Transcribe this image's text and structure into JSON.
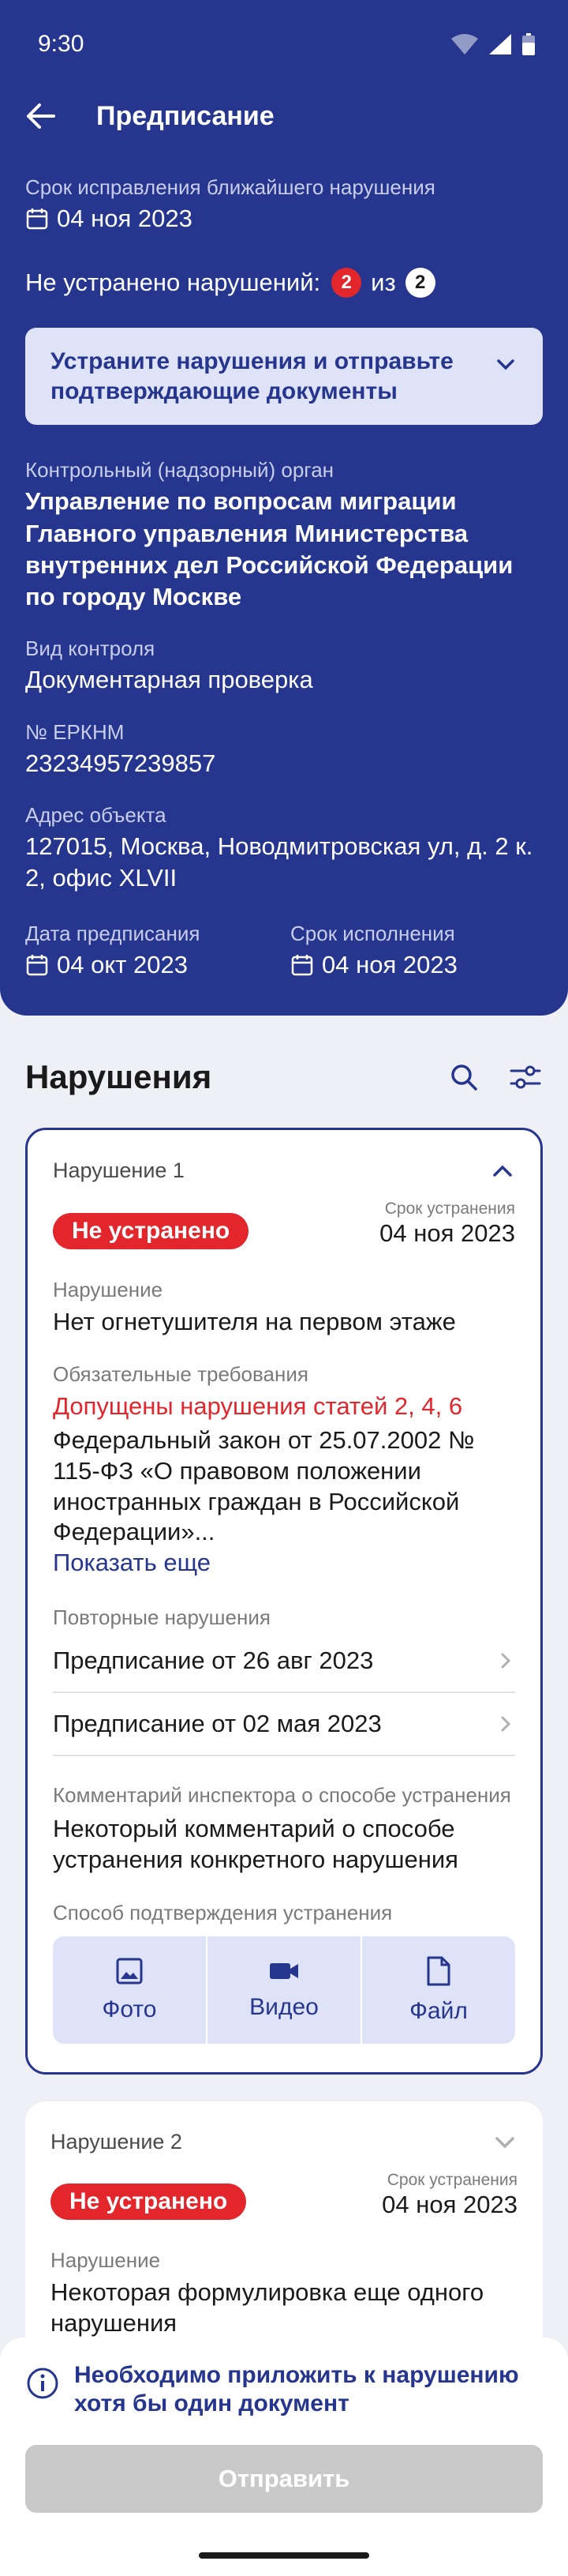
{
  "status_bar": {
    "time": "9:30"
  },
  "topbar": {
    "title": "Предписание"
  },
  "header": {
    "nearest_deadline_label": "Срок исправления ближайшего нарушения",
    "nearest_deadline_value": "04 ноя 2023",
    "unresolved_prefix": "Не устранено нарушений:",
    "unresolved_count": "2",
    "unresolved_of": "из",
    "total_count": "2",
    "alert_text": "Устраните нарушения и отправьте подтверждающие документы",
    "authority_label": "Контрольный (надзорный) орган",
    "authority_value": "Управление по вопросам миграции Главного управления Министерства внутренних дел Российской Федерации по городу Москве",
    "control_type_label": "Вид контроля",
    "control_type_value": "Документарная проверка",
    "erknm_label": "№ ЕРКНМ",
    "erknm_value": "23234957239857",
    "address_label": "Адрес объекта",
    "address_value": "127015, Москва, Новодмитровская ул, д. 2 к. 2, офис XLVII",
    "issue_date_label": "Дата предписания",
    "issue_date_value": "04 окт 2023",
    "due_date_label": "Срок исполнения",
    "due_date_value": "04 ноя 2023"
  },
  "violations_section": {
    "title": "Нарушения"
  },
  "violation1": {
    "title": "Нарушение 1",
    "status": "Не устранено",
    "deadline_label": "Срок устранения",
    "deadline_value": "04 ноя 2023",
    "violation_label": "Нарушение",
    "violation_value": "Нет огнетушителя на первом этаже",
    "requirements_label": "Обязательные требования",
    "requirements_alert": "Допущены нарушения статей 2, 4, 6",
    "requirements_text": "Федеральный закон от 25.07.2002 № 115-ФЗ «О правовом положении иностранных граждан в Российской Федерации»...",
    "show_more": "Показать еще",
    "repeat_label": "Повторные нарушения",
    "repeat_items": [
      "Предписание от 26 авг 2023",
      "Предписание от 02 мая 2023"
    ],
    "comment_label": "Комментарий инспектора о способе устранения",
    "comment_value": "Некоторый комментарий о способе устранения конкретного нарушения",
    "confirm_label": "Способ подтверждения устранения",
    "methods": [
      "Фото",
      "Видео",
      "Файл"
    ]
  },
  "violation2": {
    "title": "Нарушение 2",
    "status": "Не устранено",
    "deadline_label": "Срок устранения",
    "deadline_value": "04 ноя 2023",
    "violation_label": "Нарушение",
    "violation_value": "Некоторая формулировка еще одного нарушения"
  },
  "bottom": {
    "notice": "Необходимо приложить к нарушению хотя бы один документ",
    "submit": "Отправить"
  },
  "colors": {
    "primary": "#26368f",
    "danger": "#e3262c",
    "disabled": "#c9c9c9"
  }
}
